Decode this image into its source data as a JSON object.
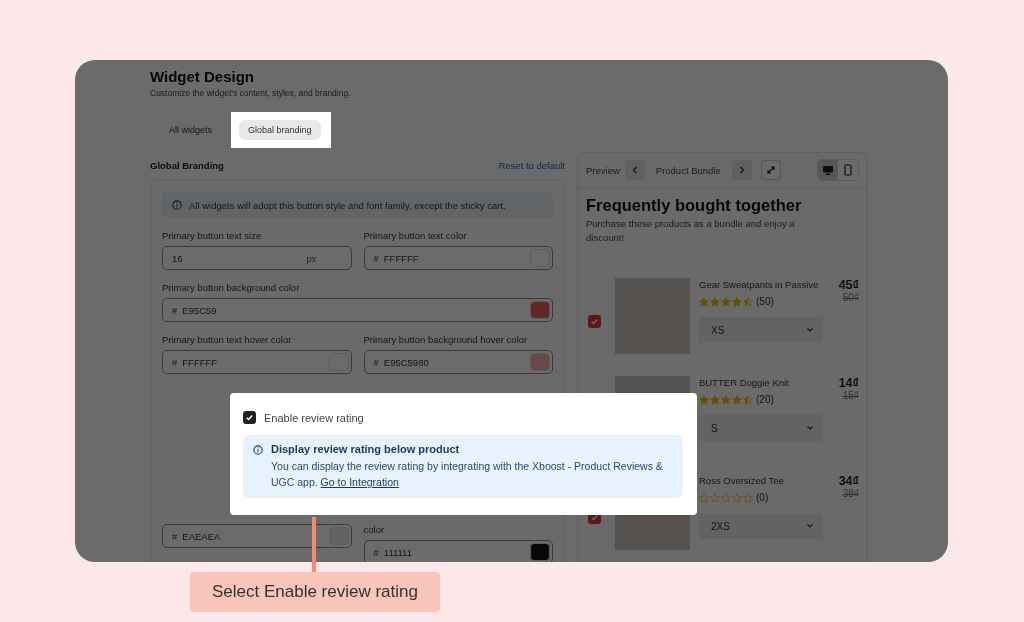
{
  "header": {
    "title": "Widget Design",
    "subtitle": "Customize the widget's content, styles, and branding."
  },
  "tabs": [
    {
      "label": "All widgets",
      "selected": false,
      "highlighted": false
    },
    {
      "label": "Global branding",
      "selected": true,
      "highlighted": true
    }
  ],
  "section": {
    "title": "Global Branding",
    "reset_link": "Reset to default"
  },
  "notice": "All widgets will adopt this button style and font family, except the sticky cart.",
  "field_rows": [
    [
      {
        "kind": "size",
        "label": "Primary button text size",
        "value": "16",
        "unit": "px"
      },
      {
        "kind": "color",
        "label": "Primary button text color",
        "prefix": "#",
        "value": "FFFFFF"
      }
    ],
    [
      {
        "kind": "color",
        "label": "Primary button background color",
        "prefix": "#",
        "value": "E95C59"
      }
    ],
    [
      {
        "kind": "color",
        "label": "Primary button text hover color",
        "prefix": "#",
        "value": "FFFFFF"
      },
      {
        "kind": "color",
        "label": "Primary button background hover color",
        "prefix": "#",
        "value": "E95C5980"
      }
    ],
    [
      {
        "kind": "color",
        "prefix": "#",
        "value": "EAEAEA"
      },
      {
        "kind": "color",
        "label": "color",
        "prefix": "#",
        "value": "111111"
      }
    ]
  ],
  "preview": {
    "label": "Preview",
    "widget": "Product Bundle",
    "devices": [
      {
        "kind": "desktop",
        "selected": true
      },
      {
        "kind": "mobile",
        "selected": false
      }
    ],
    "title": "Frequently bought together",
    "subtitle": "Purchase these products as a bundle and enjoy a discount!"
  },
  "products": [
    {
      "name": "Gear Sweatpants in Passive",
      "checked": true,
      "stars": 4.5,
      "reviews": "(50)",
      "price": "45₫",
      "old_price": "50₫",
      "size": "XS"
    },
    {
      "name": "BUTTER Doggie Knit",
      "stars": 4.5,
      "reviews": "(20)",
      "price": "14₫",
      "old_price": "15₫",
      "size": "S"
    },
    {
      "name": "Ross Oversized Tee",
      "checked": true,
      "stars": 0,
      "reviews": "(0)",
      "price": "34₫",
      "old_price": "38₫",
      "size": "2XS"
    }
  ],
  "review_popup": {
    "checkbox": {
      "label": "Enable review rating",
      "checked": true
    },
    "info_title": "Display review rating below product",
    "info_text": "You can display the review rating by integrating with the Xboost - Product Reviews & UGC app.",
    "info_link": "Go to Integration"
  },
  "callout": "Select Enable review rating"
}
